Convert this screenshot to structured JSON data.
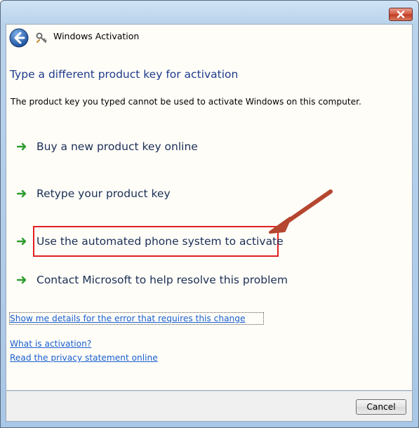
{
  "window": {
    "title": "Windows Activation"
  },
  "main": {
    "heading": "Type a different product key for activation",
    "description": "The product key you typed cannot be used to activate Windows on this computer.",
    "options": [
      {
        "label": "Buy a new product key online"
      },
      {
        "label": "Retype your product key"
      },
      {
        "label": "Use the automated phone system to activate"
      },
      {
        "label": "Contact Microsoft to help resolve this problem"
      }
    ],
    "links": [
      {
        "label": "Show me details for the error that requires this change"
      },
      {
        "label": "What is activation?"
      },
      {
        "label": "Read the privacy statement online"
      }
    ]
  },
  "footer": {
    "cancel_label": "Cancel"
  },
  "icons": {
    "close": "close-icon",
    "back": "back-arrow-icon",
    "title": "activation-key-icon",
    "option": "green-arrow-icon"
  },
  "colors": {
    "heading": "#1e3a8a",
    "link": "#1a5fcf",
    "option_arrow": "#2e9d2e",
    "highlight_box": "#e02020",
    "annotation_arrow": "#b5462f"
  }
}
